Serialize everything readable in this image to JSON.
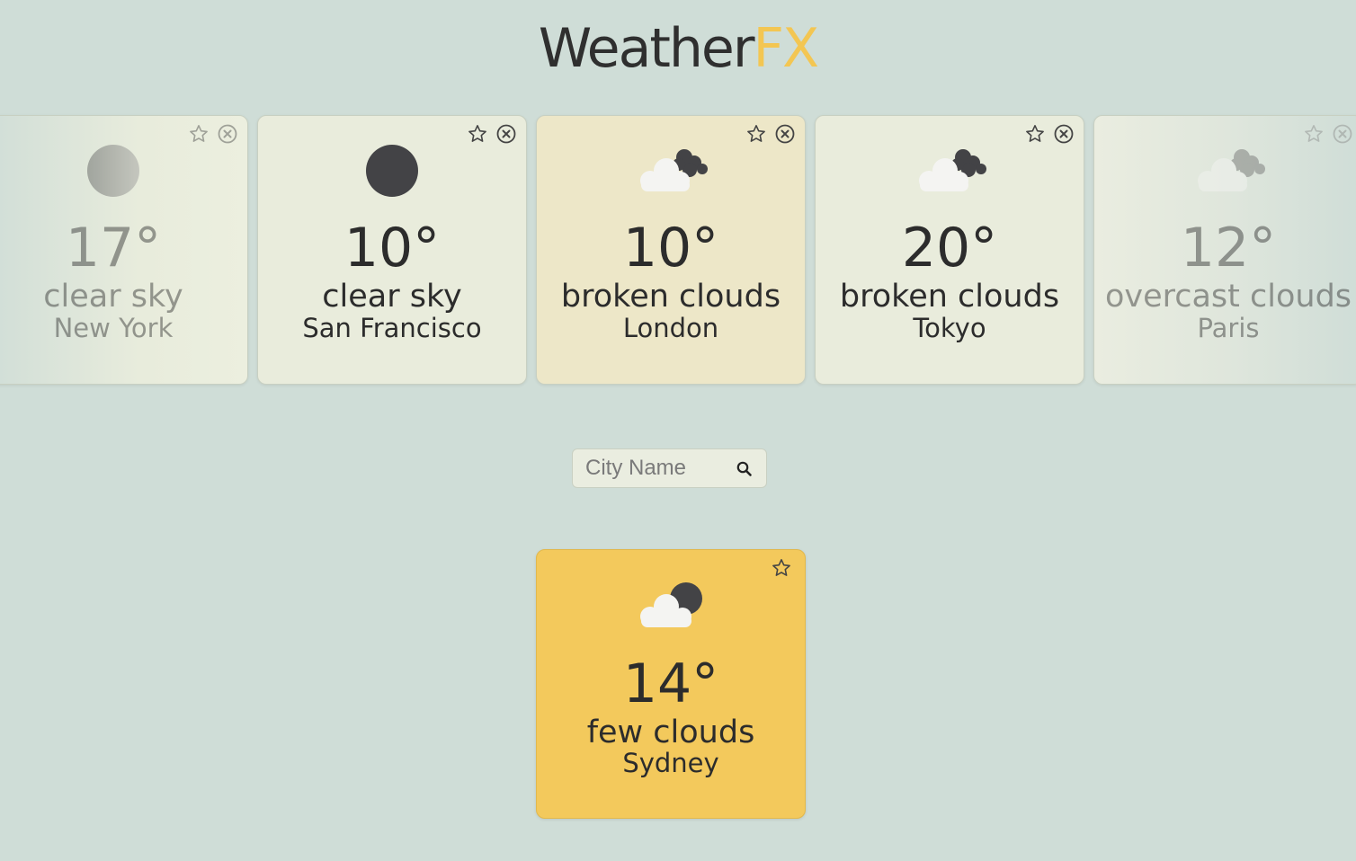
{
  "logo": {
    "main": "Weather",
    "accent": "FX"
  },
  "colors": {
    "background": "#cfddd7",
    "accent": "#f3c652",
    "active_card": "#ede7c8",
    "result_card": "#f3c95c"
  },
  "cards": [
    {
      "temp": "17°",
      "description": "clear sky",
      "city": "New York",
      "icon": "clear-night-icon"
    },
    {
      "temp": "10°",
      "description": "clear sky",
      "city": "San Francisco",
      "icon": "clear-night-icon"
    },
    {
      "temp": "10°",
      "description": "broken clouds",
      "city": "London",
      "icon": "broken-clouds-icon"
    },
    {
      "temp": "20°",
      "description": "broken clouds",
      "city": "Tokyo",
      "icon": "broken-clouds-icon"
    },
    {
      "temp": "12°",
      "description": "overcast clouds",
      "city": "Paris",
      "icon": "overcast-clouds-icon"
    }
  ],
  "search": {
    "placeholder": "City Name",
    "icon": "search-icon"
  },
  "result": {
    "temp": "14°",
    "description": "few clouds",
    "city": "Sydney",
    "icon": "few-clouds-night-icon"
  }
}
